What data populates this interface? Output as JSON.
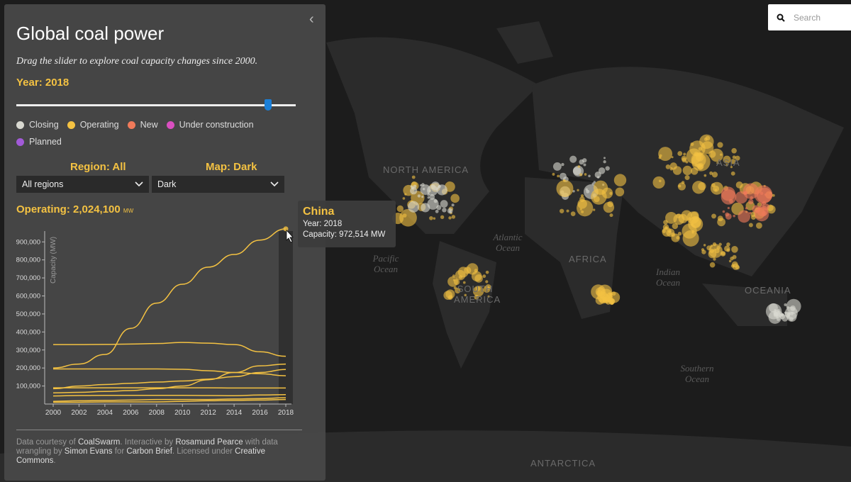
{
  "search": {
    "placeholder": "Search",
    "icon": "search-icon"
  },
  "map": {
    "labels": {
      "north_america": "NORTH AMERICA",
      "south_america": "SOUTH AMERICA",
      "africa": "AFRICA",
      "asia": "ASIA",
      "oceania": "OCEANIA",
      "antarctica": "ANTARCTICA"
    },
    "oceans": {
      "atlantic": "Atlantic Ocean",
      "pacific": "Pacific Ocean",
      "indian": "Indian Ocean",
      "southern": "Southern Ocean"
    }
  },
  "panel": {
    "title": "Global coal power",
    "subtitle": "Drag the slider to explore coal capacity changes since 2000.",
    "year_label": "Year: 2018",
    "slider": {
      "min": 2000,
      "max": 2020,
      "value": 2018
    },
    "legend": [
      {
        "label": "Closing",
        "color": "#d8d8d0"
      },
      {
        "label": "Operating",
        "color": "#f4c242"
      },
      {
        "label": "New",
        "color": "#f07a5a"
      },
      {
        "label": "Under construction",
        "color": "#d94fc0"
      },
      {
        "label": "Planned",
        "color": "#a25ad8"
      }
    ],
    "region_label": "Region: All",
    "map_label": "Map: Dark",
    "region_select": "All regions",
    "map_select": "Dark",
    "operating_label": "Operating: 2,024,100",
    "operating_unit": "MW",
    "credits": {
      "t1": "Data courtesy of ",
      "l1": "CoalSwarm",
      "t2": ". Interactive by ",
      "l2": "Rosamund Pearce",
      "t3": " with data wrangling by ",
      "l3": "Simon Evans",
      "t4": " for ",
      "l4": "Carbon Brief",
      "t5": ". Licensed under ",
      "l5": "Creative Commons",
      "t6": "."
    }
  },
  "tooltip": {
    "title": "China",
    "year": "Year: 2018",
    "capacity": "Capacity: 972,514 MW"
  },
  "chart_data": {
    "type": "line",
    "ylabel": "Capacity (MW)",
    "ylim": [
      0,
      960000
    ],
    "xlim": [
      2000,
      2018
    ],
    "x": [
      2000,
      2002,
      2004,
      2006,
      2008,
      2010,
      2012,
      2014,
      2016,
      2018
    ],
    "xticks": [
      "2000",
      "2002",
      "2004",
      "2006",
      "2008",
      "2010",
      "2012",
      "2014",
      "2016",
      "2018"
    ],
    "yticks": [
      "100,000",
      "200,000",
      "300,000",
      "400,000",
      "500,000",
      "600,000",
      "700,000",
      "800,000",
      "900,000"
    ],
    "line_color": "#f4c242",
    "highlight_year": 2018,
    "series": [
      {
        "name": "China",
        "values": [
          200000,
          222000,
          275000,
          420000,
          560000,
          665000,
          760000,
          830000,
          910000,
          972514
        ]
      },
      {
        "values": [
          330000,
          330000,
          331000,
          333000,
          336000,
          342000,
          338000,
          330000,
          290000,
          265000
        ]
      },
      {
        "values": [
          195000,
          195000,
          195000,
          195000,
          195000,
          193000,
          185000,
          175000,
          168000,
          157000
        ]
      },
      {
        "values": [
          62000,
          65000,
          70000,
          75000,
          85000,
          100000,
          135000,
          175000,
          212000,
          222000
        ]
      },
      {
        "values": [
          85000,
          100000,
          108000,
          115000,
          122000,
          128000,
          138000,
          152000,
          175000,
          192000
        ]
      },
      {
        "values": [
          90000,
          90000,
          90000,
          90000,
          90000,
          90000,
          90000,
          89000,
          89000,
          89000
        ]
      },
      {
        "values": [
          45000,
          47000,
          48000,
          48000,
          48000,
          48000,
          47000,
          46000,
          50000,
          52000
        ]
      },
      {
        "values": [
          15000,
          18000,
          20000,
          22000,
          25000,
          25000,
          25000,
          28000,
          30000,
          35000
        ]
      },
      {
        "values": [
          10000,
          10000,
          12000,
          12000,
          12000,
          15000,
          18000,
          20000,
          22000,
          25000
        ]
      }
    ]
  }
}
